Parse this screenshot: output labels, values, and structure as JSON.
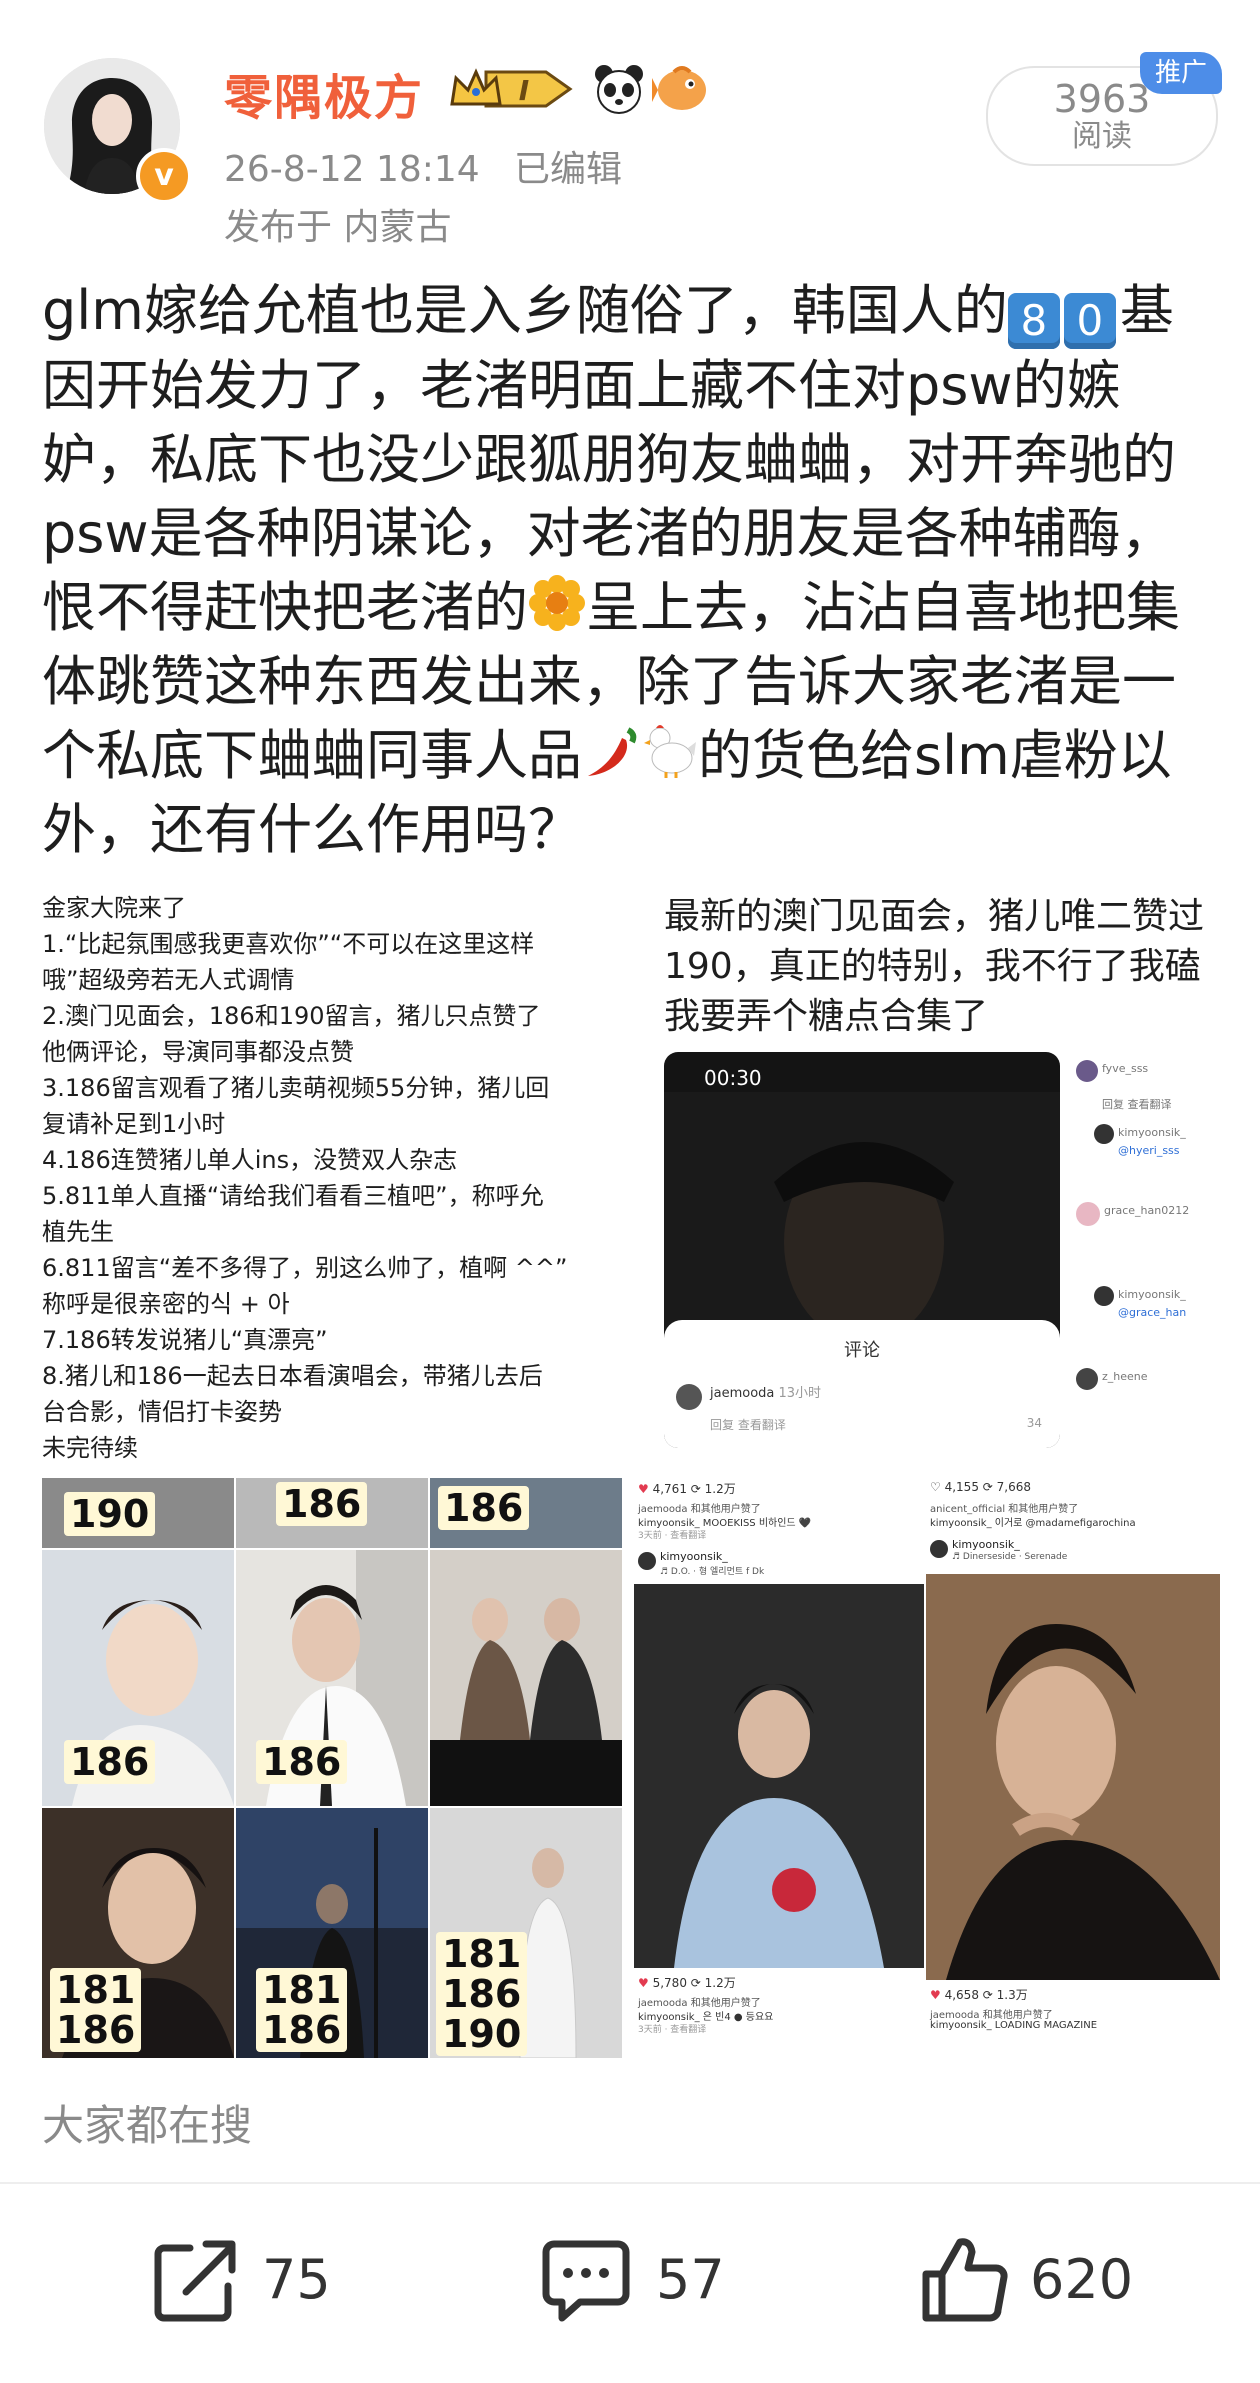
{
  "user": {
    "name": "零隅极方",
    "level_badge": "I",
    "date": "26-8-12 18:14",
    "edited": "已编辑",
    "location_label": "发布于 内蒙古"
  },
  "reads": {
    "count": "3963",
    "label": "阅读"
  },
  "promo_tag": "推广",
  "post": {
    "keycap_1": "8",
    "keycap_2": "0",
    "segments": [
      "glm嫁给允植也是入乡随俗了，韩国人的",
      "基因开始发力了，老渚明面上藏不住对psw的嫉妒，私底下也没少跟狐朋狗友蛐蛐，对开奔驰的psw是各种阴谋论，对老渚的朋友是各种辅酶，恨不得赶快把老渚的",
      "呈上去，沾沾自喜地把集体跳赞这种东西发出来，除了告诉大家老渚是一个私底下蛐蛐同事人品",
      "的货色给slm虐粉以外，还有什么作用吗？"
    ]
  },
  "image_list": {
    "title": "金家大院来了",
    "lines": [
      "1.“比起氛围感我更喜欢你”“不可以在这里这样",
      "哦”超级旁若无人式调情",
      "2.澳门见面会，186和190留言，猪儿只点赞了",
      "他俩评论，导演同事都没点赞",
      "3.186留言观看了猪儿卖萌视频55分钟，猪儿回",
      "复请补足到1小时",
      "4.186连赞猪儿单人ins，没赞双人杂志",
      "5.811单人直播“请给我们看看三植吧”，称呼允",
      "植先生",
      "6.811留言“差不多得了，别这么帅了，植啊 ^^”",
      "称呼是很亲密的식 + 아",
      "7.186转发说猪儿“真漂亮”",
      "8.猪儿和186一起去日本看演唱会，带猪儿去后",
      "台合影，情侣打卡姿势",
      "未完待续"
    ]
  },
  "image_macau": {
    "lines": [
      "最新的澳门见面会，猪儿唯二赞过",
      "190，真正的特别，我不行了我磕",
      "我要弄个糖点合集了"
    ],
    "phone_time": "00:30",
    "sheet_title": "评论",
    "comment_user": "jaemooda",
    "comment_time": "13小时",
    "comment_actions": "回复  查看翻译",
    "comment_likes": "34",
    "side_users": [
      "fyve_sss",
      "kimyoonsik_",
      "grace_han0212",
      "kimyoonsik_",
      "z_heene"
    ],
    "side_meta": [
      "回复  查看翻译",
      "@hyeri_sss",
      "@grace_han"
    ]
  },
  "grid_labels": [
    "190",
    "186",
    "186",
    "186",
    "186",
    "181\n186",
    "181\n186",
    "181\n186\n190"
  ],
  "ig_posts": [
    {
      "likes": "4,761",
      "shares": "1.2万",
      "line1": "jaemooda 和其他用户赞了",
      "line2": "kimyoonsik_ MOOEKISS 비하인드 🖤",
      "line3": "3天前 · 查看翻译",
      "user": "kimyoonsik_",
      "song": "♬ D.O. · 형 엘리먼트 f Dk"
    },
    {
      "likes": "4,155",
      "shares": "7,668",
      "line1": "anicent_official 和其他用户赞了",
      "line2": "kimyoonsik_ 이거로 @madamefigarochina",
      "line3": "",
      "user": "kimyoonsik_",
      "song": "♬ Dinerseside · Serenade"
    },
    {
      "likes": "5,780",
      "shares": "1.2万",
      "line1": "jaemooda 和其他用户赞了",
      "line2": "kimyoonsik_ 은 빈4 ● 등요요",
      "line3": "3天前 · 查看翻译"
    },
    {
      "likes": "4,658",
      "shares": "1.3万",
      "line1": "jaemooda 和其他用户赞了",
      "line2": "kimyoonsik_ LOADING MAGAZINE",
      "line3": ""
    }
  ],
  "search_label": "大家都在搜",
  "actions": {
    "share": "75",
    "comment": "57",
    "like": "620"
  },
  "colors": {
    "username": "#f0603b",
    "meta": "#8a8a8a",
    "promo": "#4d8de8",
    "badge": "#f59a23"
  }
}
